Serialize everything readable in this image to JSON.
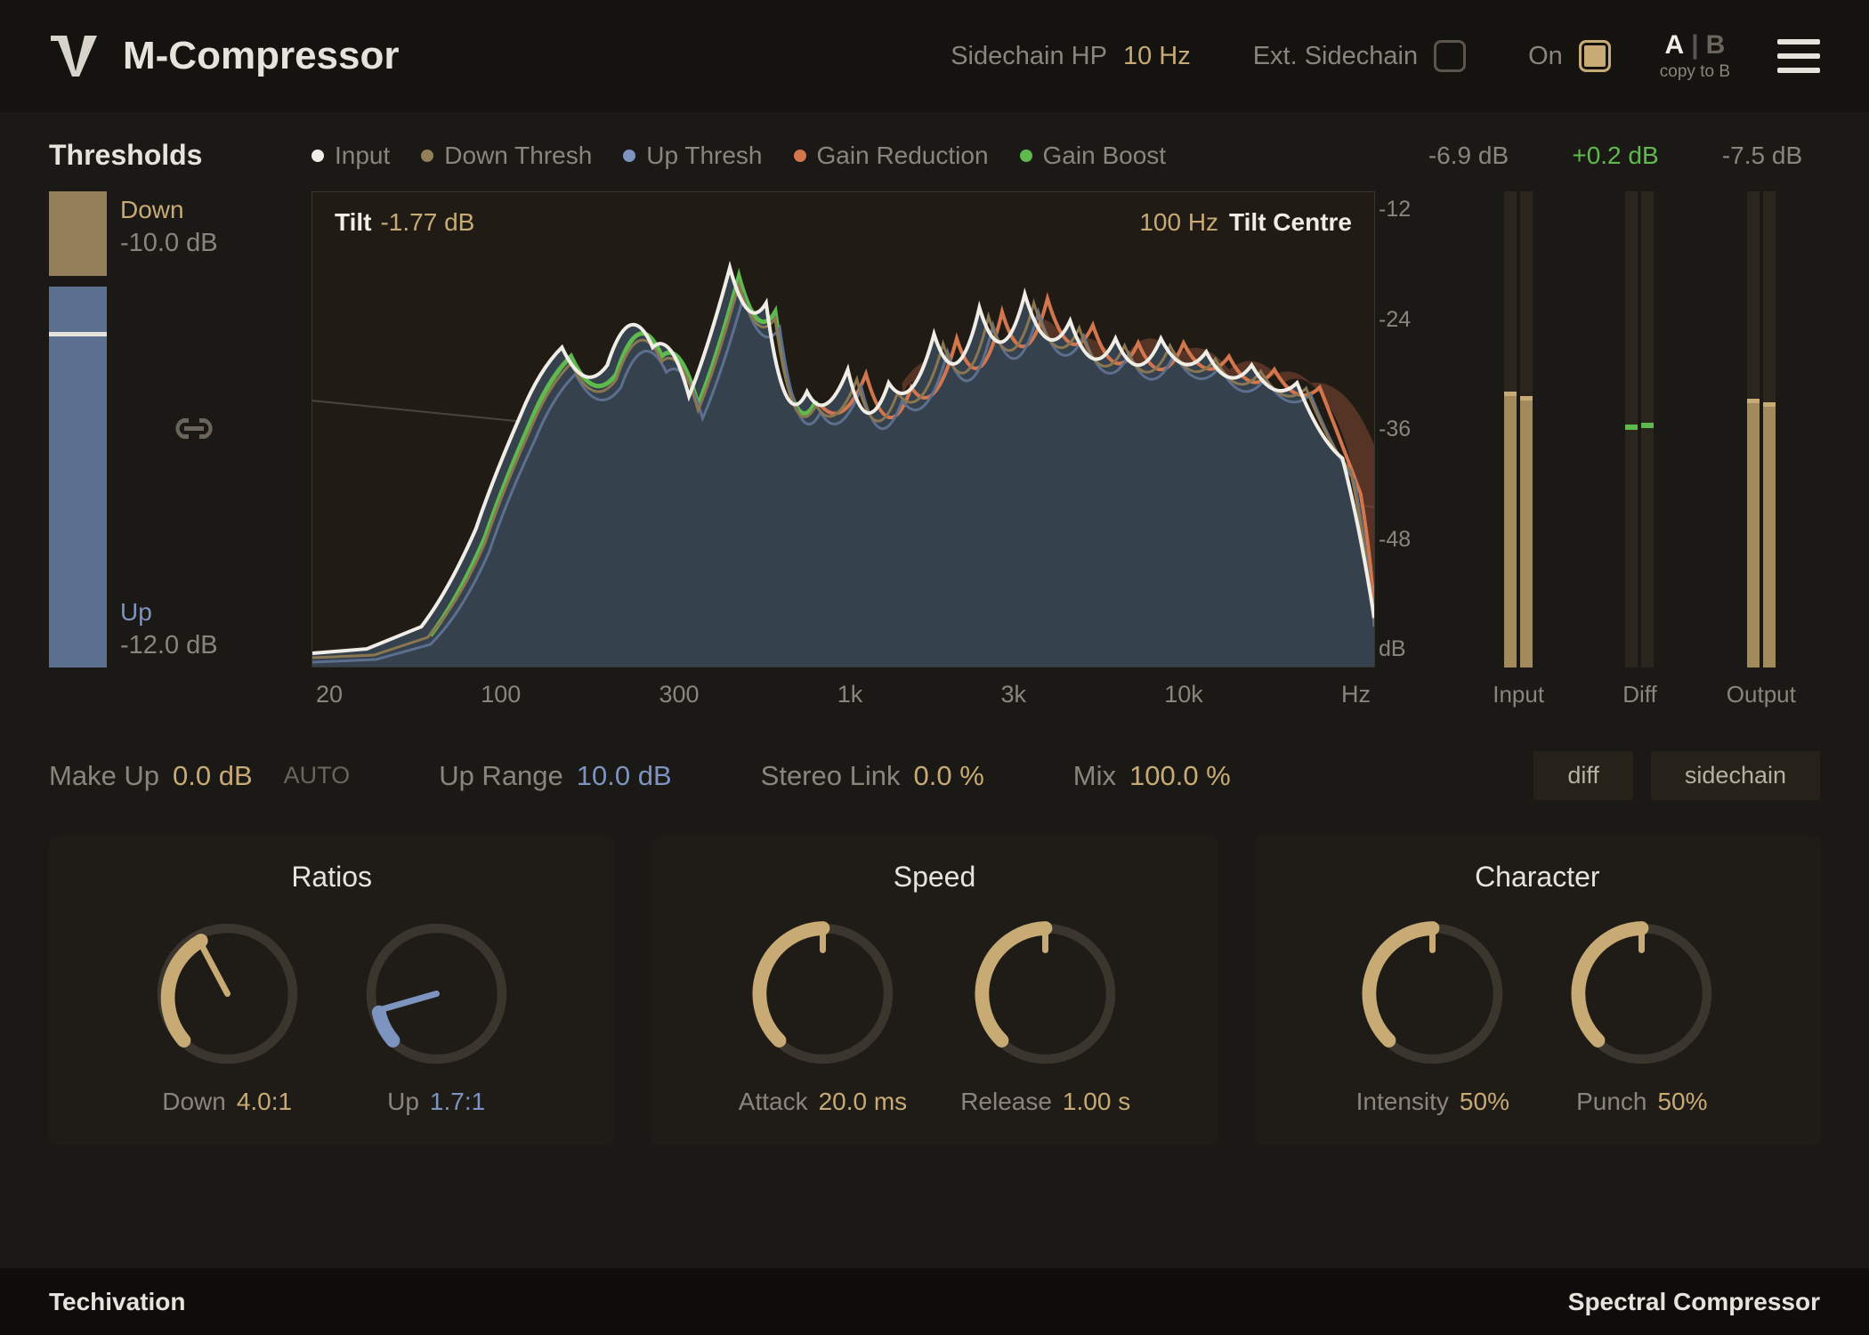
{
  "header": {
    "plugin_name": "M-Compressor",
    "sidechain_hp_label": "Sidechain HP",
    "sidechain_hp_value": "10 Hz",
    "ext_sidechain_label": "Ext. Sidechain",
    "ext_sidechain_on": false,
    "on_label": "On",
    "on_state": true,
    "ab_a": "A",
    "ab_b": "B",
    "copy_label": "copy to B"
  },
  "legend": {
    "section": "Thresholds",
    "items": [
      {
        "label": "Input",
        "color": "#f0ede6"
      },
      {
        "label": "Down Thresh",
        "color": "#93805a"
      },
      {
        "label": "Up Thresh",
        "color": "#7d93c0"
      },
      {
        "label": "Gain Reduction",
        "color": "#d4764d"
      },
      {
        "label": "Gain Boost",
        "color": "#5fba4d"
      }
    ]
  },
  "meter_readings": {
    "input_db": "-6.9 dB",
    "diff_db": "+0.2 dB",
    "output_db": "-7.5 dB"
  },
  "thresholds": {
    "down_label": "Down",
    "down_value": "-10.0 dB",
    "up_label": "Up",
    "up_value": "-12.0 dB"
  },
  "graph": {
    "tilt_label": "Tilt",
    "tilt_value": "-1.77 dB",
    "centre_value": "100 Hz",
    "centre_label": "Tilt Centre",
    "y_ticks": [
      "-12",
      "-24",
      "-36",
      "-48",
      "dB"
    ],
    "x_ticks": [
      "20",
      "100",
      "300",
      "1k",
      "3k",
      "10k",
      "Hz"
    ]
  },
  "meters": {
    "input": "Input",
    "diff": "Diff",
    "output": "Output"
  },
  "params": {
    "makeup_label": "Make Up",
    "makeup_value": "0.0 dB",
    "auto_label": "AUTO",
    "uprange_label": "Up Range",
    "uprange_value": "10.0 dB",
    "stereo_label": "Stereo Link",
    "stereo_value": "0.0 %",
    "mix_label": "Mix",
    "mix_value": "100.0 %",
    "diff_btn": "diff",
    "sidechain_btn": "sidechain"
  },
  "panels": {
    "ratios": {
      "title": "Ratios",
      "down_label": "Down",
      "down_value": "4.0:1",
      "up_label": "Up",
      "up_value": "1.7:1"
    },
    "speed": {
      "title": "Speed",
      "attack_label": "Attack",
      "attack_value": "20.0 ms",
      "release_label": "Release",
      "release_value": "1.00 s"
    },
    "character": {
      "title": "Character",
      "intensity_label": "Intensity",
      "intensity_value": "50%",
      "punch_label": "Punch",
      "punch_value": "50%"
    }
  },
  "footer": {
    "brand": "Techivation",
    "product": "Spectral Compressor"
  }
}
